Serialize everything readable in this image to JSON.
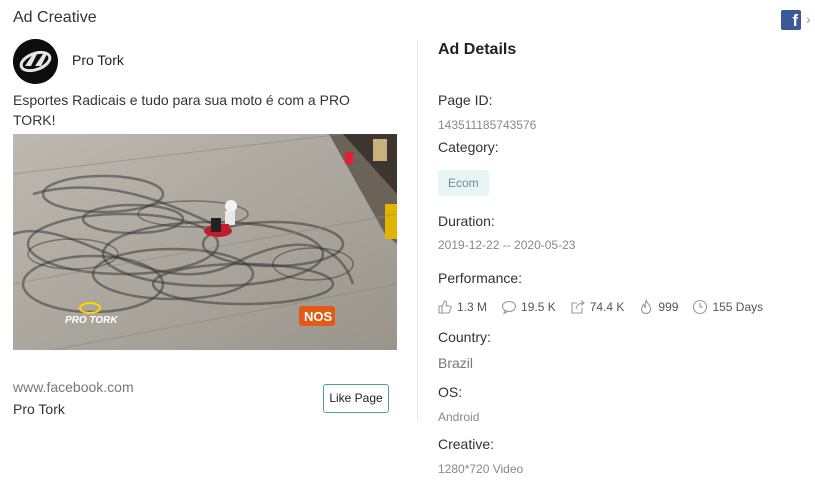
{
  "header": {
    "title": "Ad Creative",
    "fb_icon": "facebook-icon",
    "chevron_icon": "chevron-right-icon"
  },
  "advertiser": {
    "name": "Pro Tork",
    "avatar_icon": "pro-tork-logo"
  },
  "ad": {
    "text": "Esportes Radicais e tudo para sua moto é com a PRO TORK!",
    "image_watermark_left": "PRO TORK",
    "image_watermark_right": "NOS",
    "site_url": "www.facebook.com",
    "page_name": "Pro Tork",
    "like_button": "Like Page"
  },
  "details": {
    "title": "Ad Details",
    "page_id_label": "Page ID:",
    "page_id": "143511185743576",
    "category_label": "Category:",
    "category": "Ecom",
    "duration_label": "Duration:",
    "duration": "2019-12-22 -- 2020-05-23",
    "performance_label": "Performance:",
    "performance": {
      "likes": "1.3 M",
      "comments": "19.5 K",
      "shares": "74.4 K",
      "hot": "999",
      "days": "155 Days"
    },
    "country_label": "Country:",
    "country": "Brazil",
    "os_label": "OS:",
    "os": "Android",
    "creative_label": "Creative:",
    "creative": "1280*720 Video"
  }
}
